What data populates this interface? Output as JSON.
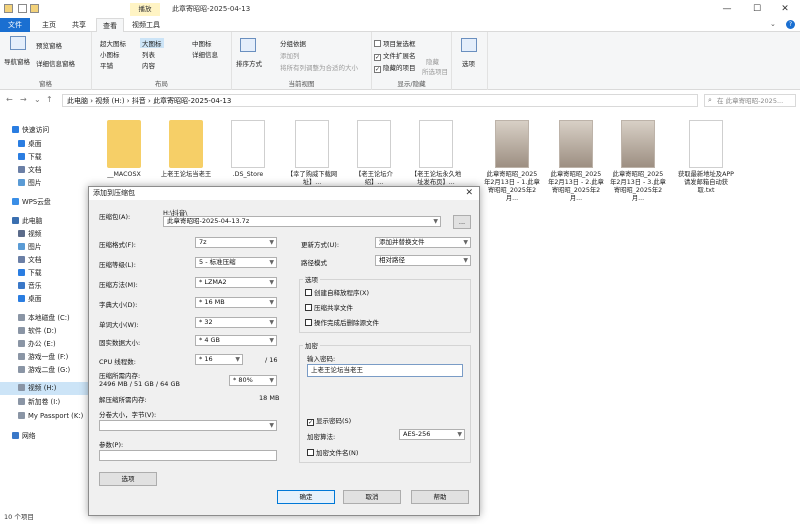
{
  "window": {
    "title": "此章寄昭昭-2025-04-13",
    "context_tab": "播放",
    "controls": [
      "—",
      "☐",
      "✕"
    ]
  },
  "ribbon": {
    "tabs": [
      "文件",
      "主页",
      "共享",
      "查看",
      "视频工具"
    ],
    "groups": {
      "pane": {
        "label": "窗格",
        "nav_pane": "导航窗格",
        "preview": "预览窗格",
        "details": "详细信息窗格"
      },
      "layout": {
        "label": "布局",
        "items": [
          "超大图标",
          "大图标",
          "中图标",
          "小图标",
          "列表",
          "详细信息",
          "平铺",
          "内容"
        ]
      },
      "current_view": {
        "label": "当前视图",
        "sort": "排序方式",
        "group_by": "分组依据",
        "add_column": "添加列",
        "fit_columns": "将所有列调整为合适的大小"
      },
      "show_hide": {
        "label": "显示/隐藏",
        "item_checkbox": "项目复选框",
        "file_ext": "文件扩展名",
        "hidden_items": "隐藏的项目",
        "hide_selected": "隐藏",
        "hide_selected2": "所选项目",
        "options": "选项"
      }
    }
  },
  "address": {
    "path": [
      "此电脑",
      "视频 (H:)",
      "抖音",
      "此章寄昭昭-2025-04-13"
    ],
    "search_placeholder": "在 此章寄昭昭-2025..."
  },
  "sidebar": {
    "items": [
      {
        "label": "快速访问",
        "icon": "star-icon"
      },
      {
        "label": "桌面",
        "icon": "desktop-icon"
      },
      {
        "label": "下载",
        "icon": "download-icon"
      },
      {
        "label": "文档",
        "icon": "document-icon"
      },
      {
        "label": "图片",
        "icon": "picture-icon"
      },
      {
        "label": "WPS云盘",
        "icon": "cloud-icon"
      },
      {
        "label": "此电脑",
        "icon": "computer-icon"
      },
      {
        "label": "视频",
        "icon": "video-icon"
      },
      {
        "label": "图片",
        "icon": "picture-icon"
      },
      {
        "label": "文档",
        "icon": "document-icon"
      },
      {
        "label": "下载",
        "icon": "download-icon"
      },
      {
        "label": "音乐",
        "icon": "music-icon"
      },
      {
        "label": "桌面",
        "icon": "desktop-icon"
      },
      {
        "label": "本地磁盘 (C:)",
        "icon": "drive-icon"
      },
      {
        "label": "软件 (D:)",
        "icon": "drive-icon"
      },
      {
        "label": "办公 (E:)",
        "icon": "drive-icon"
      },
      {
        "label": "游戏一盘 (F:)",
        "icon": "drive-icon"
      },
      {
        "label": "游戏二盘 (G:)",
        "icon": "drive-icon"
      },
      {
        "label": "视频 (H:)",
        "icon": "drive-icon"
      },
      {
        "label": "新加卷 (I:)",
        "icon": "drive-icon"
      },
      {
        "label": "My Passport (K:)",
        "icon": "drive-icon"
      },
      {
        "label": "网络",
        "icon": "network-icon"
      }
    ]
  },
  "files": [
    {
      "name": "__MACOSX",
      "kind": "folder"
    },
    {
      "name": "上老王论坛当老王",
      "kind": "folder"
    },
    {
      "name": ".DS_Store",
      "kind": "doc"
    },
    {
      "name": "【幸了购威下载网址】...",
      "kind": "doc"
    },
    {
      "name": "【老王论坛介绍】...",
      "kind": "doc"
    },
    {
      "name": "【老王论坛永久地址发布页】...",
      "kind": "doc"
    },
    {
      "name": "此章寄昭昭_2025年2月13日 - 1.此章寄昭昭_2025年2月...",
      "kind": "photo"
    },
    {
      "name": "此章寄昭昭_2025年2月13日 - 2.此章寄昭昭_2025年2月...",
      "kind": "photo"
    },
    {
      "name": "此章寄昭昭_2025年2月13日 - 3.此章寄昭昭_2025年2月...",
      "kind": "photo"
    },
    {
      "name": "获取最新地址及APP请发邮箱自动获取.txt",
      "kind": "doc"
    }
  ],
  "status": {
    "count": "10 个项目"
  },
  "dialog": {
    "title": "添加到压缩包",
    "archive_label": "压缩包(A):",
    "archive_dir": "H:\\抖音\\",
    "archive_name": "此章寄昭昭-2025-04-13.7z",
    "browse": "...",
    "format_label": "压缩格式(F):",
    "format": "7z",
    "level_label": "压缩等级(L):",
    "level": "5 - 标准压缩",
    "method_label": "压缩方法(M):",
    "method": "* LZMA2",
    "dict_label": "字典大小(D):",
    "dict": "* 16 MB",
    "word_label": "单词大小(W):",
    "word": "* 32",
    "solid_label": "固实数据大小:",
    "solid": "* 4 GB",
    "threads_label": "CPU 线程数:",
    "threads": "* 16",
    "threads_max": "/ 16",
    "mem_label": "压缩所需内存:",
    "mem_info": "2496 MB / 51 GB / 64 GB",
    "mem_pct": "* 80%",
    "decomp_label": "解压缩所需内存:",
    "decomp_value": "18 MB",
    "split_label": "分卷大小，字节(V):",
    "params_label": "参数(P):",
    "options_btn": "选项",
    "update_label": "更新方式(U):",
    "update": "添加并替换文件",
    "pathmode_label": "路径模式",
    "pathmode": "相对路径",
    "options_group": "选项",
    "opt_sfx": "创建自释放程序(X)",
    "opt_shared": "压缩共享文件",
    "opt_delete": "操作完成后删除源文件",
    "encrypt_group": "加密",
    "pwd_label": "输入密码:",
    "pwd_value": "上老王论坛当老王",
    "show_pwd": "显示密码(S)",
    "enc_method_label": "加密算法:",
    "enc_method": "AES-256",
    "enc_names": "加密文件名(N)",
    "ok": "确定",
    "cancel": "取消",
    "help": "帮助"
  }
}
